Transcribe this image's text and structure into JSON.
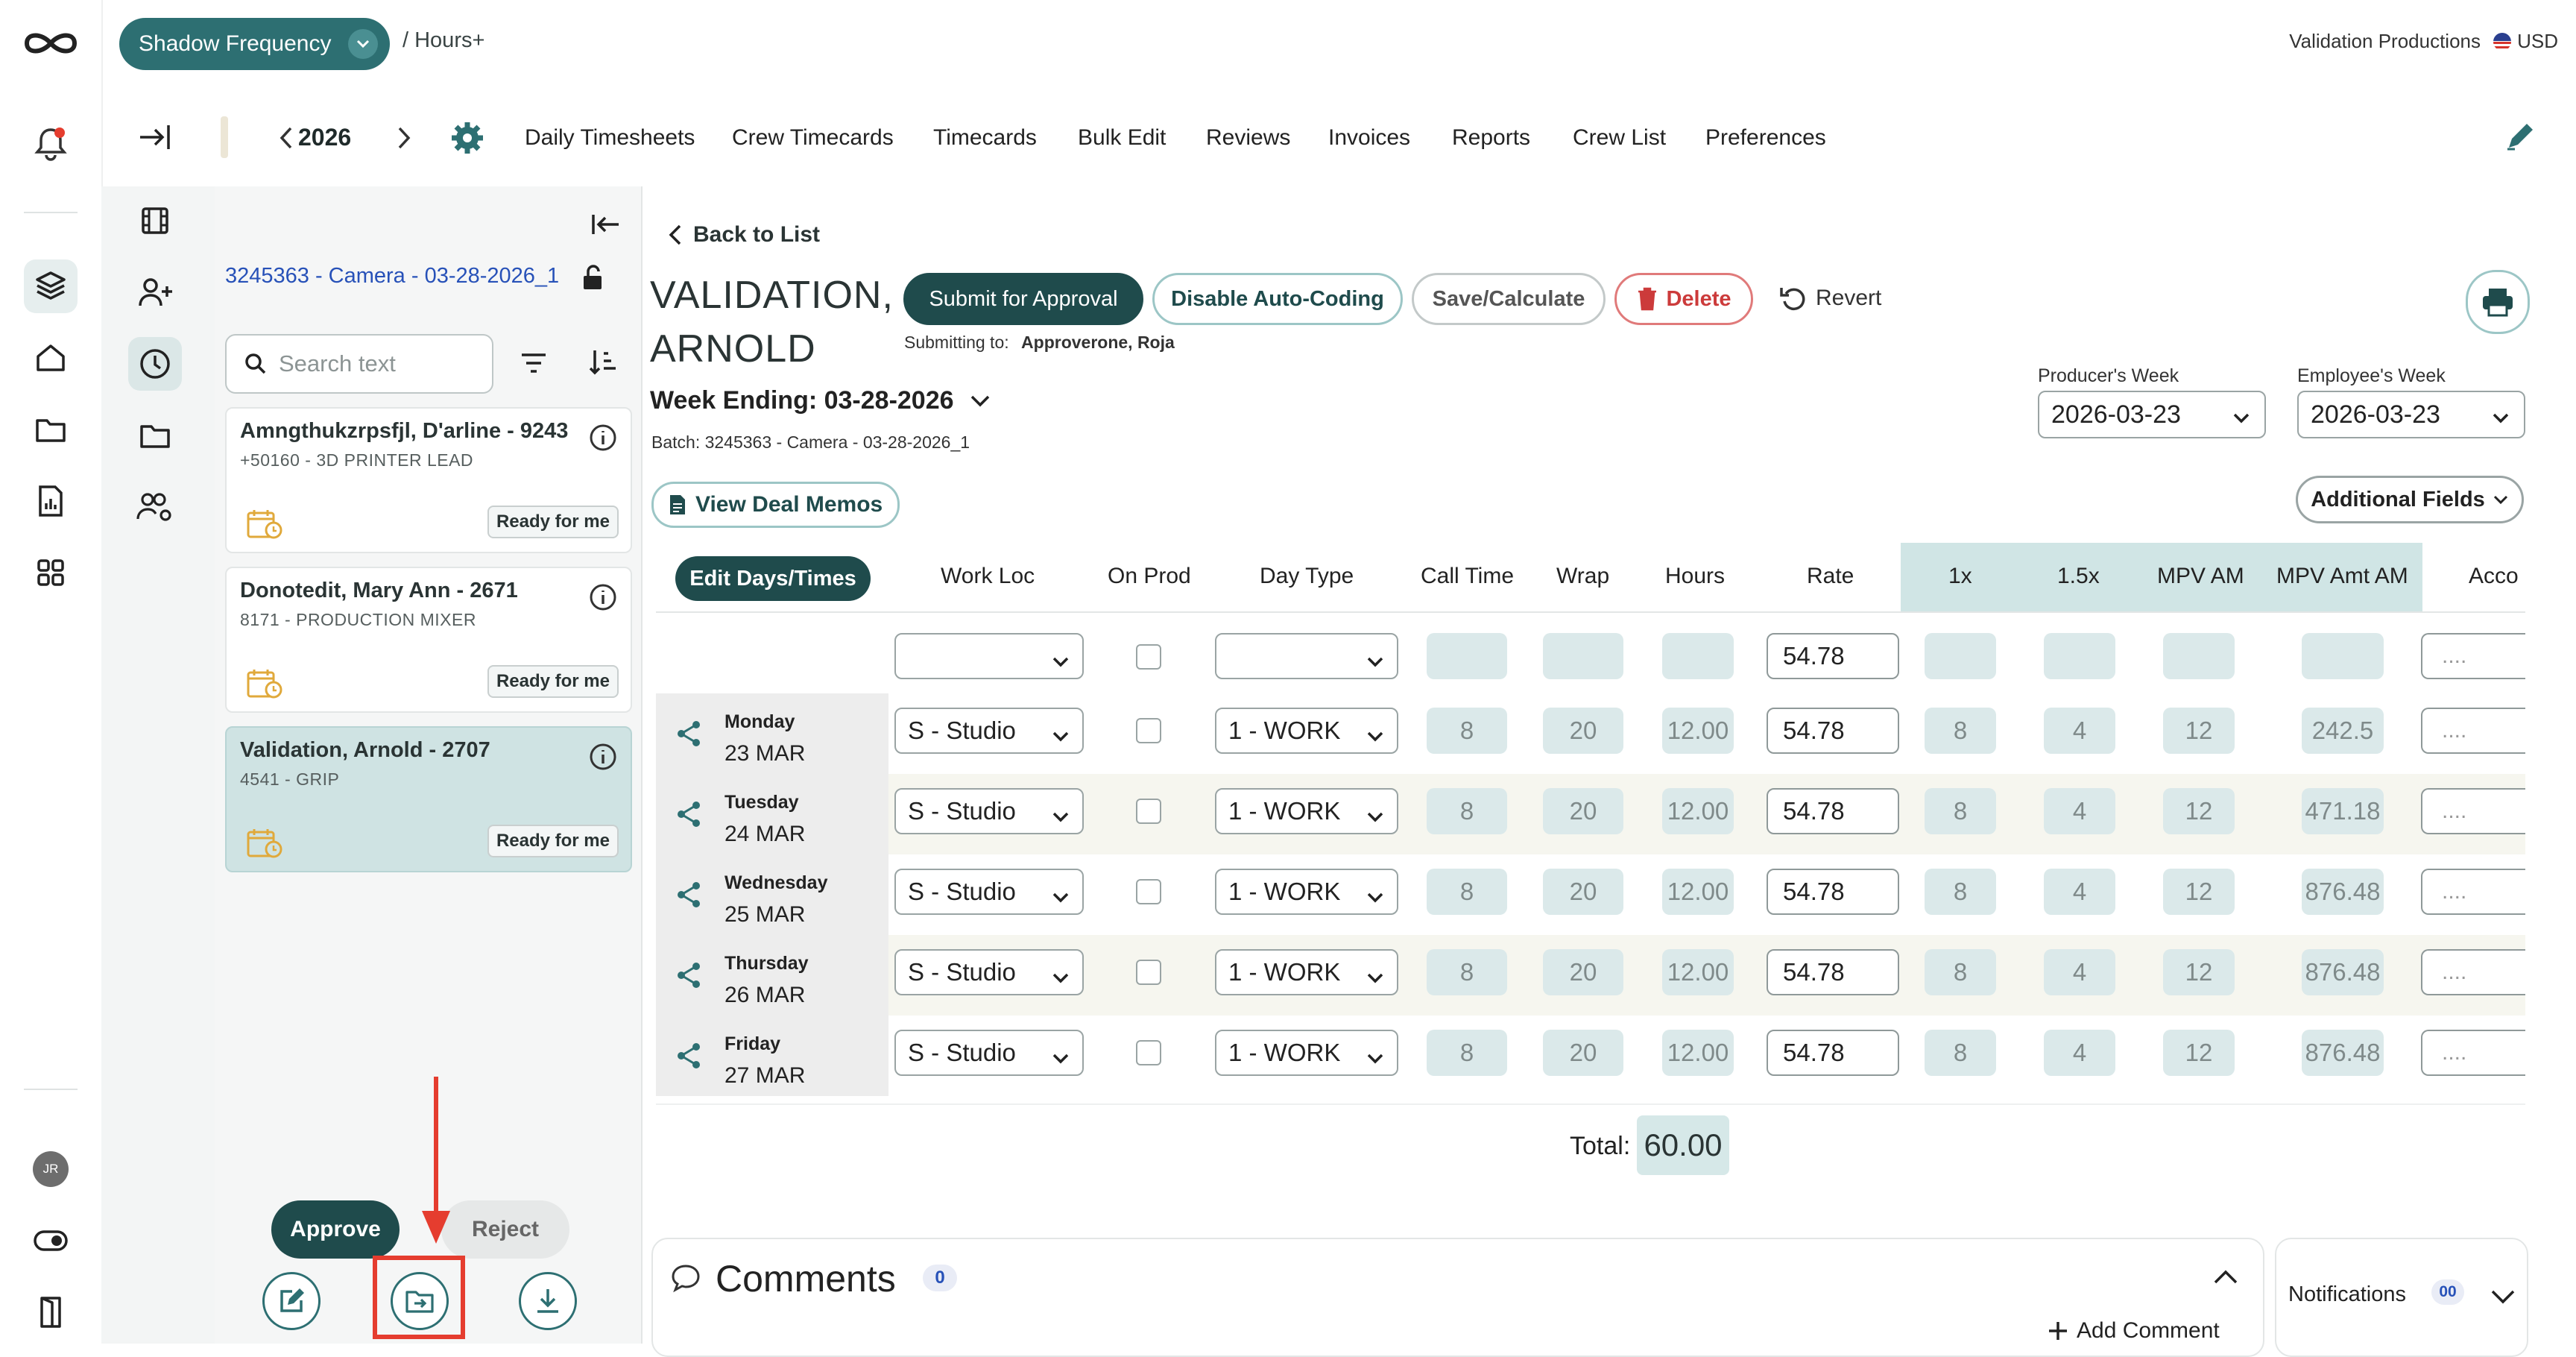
{
  "header": {
    "project_name": "Shadow Frequency",
    "breadcrumb": "/ Hours+",
    "company": "Validation Productions",
    "currency": "USD"
  },
  "nav": {
    "year": "2026",
    "items": [
      "Daily Timesheets",
      "Crew Timecards",
      "Timecards",
      "Bulk Edit",
      "Reviews",
      "Invoices",
      "Reports",
      "Crew List",
      "Preferences"
    ]
  },
  "list": {
    "batch": "3245363 - Camera - 03-28-2026_1",
    "search_placeholder": "Search text",
    "cards": [
      {
        "name": "Amngthukzrpsfjl, D'arline - 9243",
        "role": "+50160 - 3D PRINTER LEAD",
        "badge": "Ready for me"
      },
      {
        "name": "Donotedit, Mary Ann - 2671",
        "role": "8171 - PRODUCTION MIXER",
        "badge": "Ready for me"
      },
      {
        "name": "Validation, Arnold - 2707",
        "role": "4541 - GRIP",
        "badge": "Ready for me"
      }
    ],
    "approve_label": "Approve",
    "reject_label": "Reject"
  },
  "user_initials": "JR",
  "main": {
    "back_label": "Back to List",
    "employee_line1": "VALIDATION,",
    "employee_line2": "ARNOLD",
    "submit_label": "Submit for Approval",
    "autocoding_label": "Disable Auto-Coding",
    "save_label": "Save/Calculate",
    "delete_label": "Delete",
    "revert_label": "Revert",
    "submitting_to_label": "Submitting to:",
    "submitting_to_value": "Approverone, Roja",
    "week_ending": "Week Ending: 03-28-2026",
    "batch_line": "Batch: 3245363 - Camera - 03-28-2026_1",
    "producers_week_label": "Producer's Week",
    "producers_week_value": "2026-03-23",
    "employees_week_label": "Employee's Week",
    "employees_week_value": "2026-03-23",
    "deal_memos_label": "View Deal Memos",
    "additional_fields_label": "Additional Fields"
  },
  "table": {
    "edit_days_label": "Edit Days/Times",
    "headers": [
      "Work Loc",
      "On Prod",
      "Day Type",
      "Call Time",
      "Wrap",
      "Hours",
      "Rate",
      "1x",
      "1.5x",
      "MPV AM",
      "MPV Amt AM",
      "Acco"
    ],
    "template_row": {
      "rate": "54.78",
      "account": "...."
    },
    "rows": [
      {
        "day": "Monday",
        "date": "23 MAR",
        "work_loc": "S - Studio",
        "day_type": "1 - WORK",
        "call": "8",
        "wrap": "20",
        "hours": "12.00",
        "rate": "54.78",
        "x1": "8",
        "x15": "4",
        "mpv_am": "12",
        "mpv_amt": "242.5",
        "account": "...."
      },
      {
        "day": "Tuesday",
        "date": "24 MAR",
        "work_loc": "S - Studio",
        "day_type": "1 - WORK",
        "call": "8",
        "wrap": "20",
        "hours": "12.00",
        "rate": "54.78",
        "x1": "8",
        "x15": "4",
        "mpv_am": "12",
        "mpv_amt": "471.18",
        "account": "...."
      },
      {
        "day": "Wednesday",
        "date": "25 MAR",
        "work_loc": "S - Studio",
        "day_type": "1 - WORK",
        "call": "8",
        "wrap": "20",
        "hours": "12.00",
        "rate": "54.78",
        "x1": "8",
        "x15": "4",
        "mpv_am": "12",
        "mpv_amt": "876.48",
        "account": "...."
      },
      {
        "day": "Thursday",
        "date": "26 MAR",
        "work_loc": "S - Studio",
        "day_type": "1 - WORK",
        "call": "8",
        "wrap": "20",
        "hours": "12.00",
        "rate": "54.78",
        "x1": "8",
        "x15": "4",
        "mpv_am": "12",
        "mpv_amt": "876.48",
        "account": "...."
      },
      {
        "day": "Friday",
        "date": "27 MAR",
        "work_loc": "S - Studio",
        "day_type": "1 - WORK",
        "call": "8",
        "wrap": "20",
        "hours": "12.00",
        "rate": "54.78",
        "x1": "8",
        "x15": "4",
        "mpv_am": "12",
        "mpv_amt": "876.48",
        "account": "...."
      }
    ],
    "total_label": "Total:",
    "total_value": "60.00"
  },
  "comments": {
    "title": "Comments",
    "count": "0",
    "add_label": "Add Comment"
  },
  "notifications": {
    "title": "Notifications",
    "count": "00"
  },
  "colors": {
    "brand": "#2d6f72",
    "dark": "#1f4b4c",
    "highlight": "#e53d2f",
    "delete": "#cc3b3b"
  }
}
